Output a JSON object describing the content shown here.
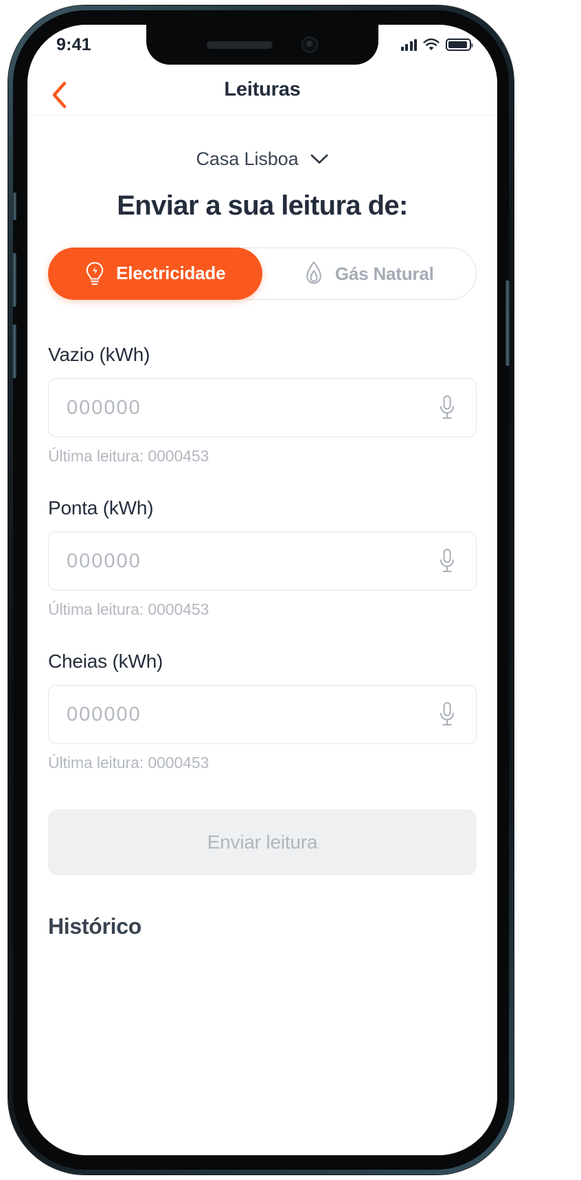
{
  "status_bar": {
    "time": "9:41",
    "signal_icon": "cellular-bars-icon",
    "wifi_icon": "wifi-icon",
    "battery_icon": "battery-icon"
  },
  "navbar": {
    "back_icon": "chevron-left-icon",
    "title": "Leituras"
  },
  "house_selector": {
    "label": "Casa Lisboa",
    "chevron_icon": "chevron-down-icon"
  },
  "heading": "Enviar a sua leitura de:",
  "segmented_control": {
    "options": [
      {
        "label": "Electricidade",
        "icon": "lightbulb-icon",
        "selected": true
      },
      {
        "label": "Gás Natural",
        "icon": "flame-icon",
        "selected": false
      }
    ]
  },
  "fields": [
    {
      "label": "Vazio (kWh)",
      "value": "",
      "placeholder": "000000",
      "mic_icon": "microphone-icon",
      "hint": "Última leitura: 0000453"
    },
    {
      "label": "Ponta (kWh)",
      "value": "",
      "placeholder": "000000",
      "mic_icon": "microphone-icon",
      "hint": "Última leitura: 0000453"
    },
    {
      "label": "Cheias (kWh)",
      "value": "",
      "placeholder": "000000",
      "mic_icon": "microphone-icon",
      "hint": "Última leitura: 0000453"
    }
  ],
  "submit": {
    "label": "Enviar leitura",
    "enabled": false
  },
  "history": {
    "title": "Histórico"
  },
  "colors": {
    "accent": "#f9591e",
    "text_dark": "#242d3c",
    "text_muted": "#b3b8c0",
    "border": "#e2e5e9",
    "disabled_bg": "#eef0f2"
  }
}
